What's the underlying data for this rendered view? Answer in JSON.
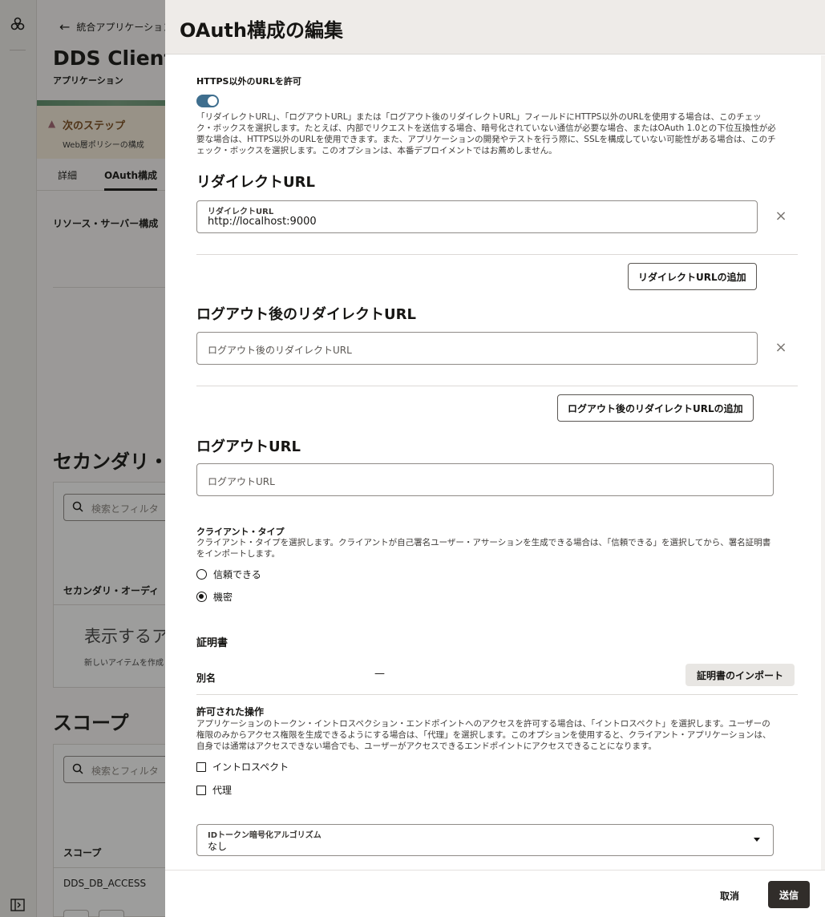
{
  "rail": {
    "logo_icon": "logo-icon",
    "toggle_icon": "panel-toggle-icon"
  },
  "background": {
    "back_label": "統合アプリケーション",
    "app_title": "DDS Client",
    "app_subtitle": "アプリケーション",
    "next_step": {
      "title": "次のステップ",
      "text": "Web層ポリシーの構成"
    },
    "tabs": [
      {
        "label": "詳細"
      },
      {
        "label": "OAuth構成"
      }
    ],
    "resource_server_label": "リソース・サーバー構成",
    "secondary_heading": "セカンダリ・",
    "secondary_card": {
      "search_placeholder": "検索とフィルタ",
      "column": "セカンダリ・オーディ",
      "empty_title": "表示するア",
      "empty_text": "新しいアイテムを作成"
    },
    "scope_heading": "スコープ",
    "scope_card": {
      "search_placeholder": "検索とフィルタ",
      "column": "スコープ",
      "row": "DDS_DB_ACCESS"
    }
  },
  "drawer": {
    "title": "OAuth構成の編集",
    "allow_non_https": {
      "label": "HTTPS以外のURLを許可",
      "enabled": true,
      "help": "「リダイレクトURL」、「ログアウトURL」または「ログアウト後のリダイレクトURL」フィールドにHTTPS以外のURLを使用する場合は、このチェック・ボックスを選択します。たとえば、内部でリクエストを送信する場合、暗号化されていない通信が必要な場合、またはOAuth 1.0との下位互換性が必要な場合は、HTTPS以外のURLを使用できます。また、アプリケーションの開発やテストを行う際に、SSLを構成していない可能性がある場合は、このチェック・ボックスを選択します。このオプションは、本番デプロイメントではお薦めしません。"
    },
    "redirect": {
      "heading": "リダイレクトURL",
      "field_label": "リダイレクトURL",
      "value": "http://localhost:9000",
      "add_button": "リダイレクトURLの追加"
    },
    "post_logout": {
      "heading": "ログアウト後のリダイレクトURL",
      "placeholder": "ログアウト後のリダイレクトURL",
      "add_button": "ログアウト後のリダイレクトURLの追加"
    },
    "logout": {
      "heading": "ログアウトURL",
      "placeholder": "ログアウトURL"
    },
    "client_type": {
      "label": "クライアント・タイプ",
      "help": "クライアント・タイプを選択します。クライアントが自己署名ユーザー・アサーションを生成できる場合は、「信頼できる」を選択してから、署名証明書をインポートします。",
      "options": [
        {
          "label": "信頼できる",
          "selected": false
        },
        {
          "label": "機密",
          "selected": true
        }
      ]
    },
    "certificate": {
      "heading": "証明書",
      "alias_label": "別名",
      "alias_value": "—",
      "import_button": "証明書のインポート"
    },
    "allowed_ops": {
      "label": "許可された操作",
      "help": "アプリケーションのトークン・イントロスペクション・エンドポイントへのアクセスを許可する場合は、「イントロスペクト」を選択します。ユーザーの権限のみからアクセス権限を生成できるようにする場合は、「代理」を選択します。このオプションを使用すると、クライアント・アプリケーションは、自身では通常はアクセスできない場合でも、ユーザーがアクセスできるエンドポイントにアクセスできることになります。",
      "options": [
        {
          "label": "イントロスペクト",
          "checked": false
        },
        {
          "label": "代理",
          "checked": false
        }
      ]
    },
    "id_token_encryption": {
      "label": "IDトークン暗号化アルゴリズム",
      "value": "なし"
    },
    "footer": {
      "cancel": "取消",
      "submit": "送信"
    }
  },
  "colors": {
    "accent": "#3e6e8e",
    "primary_button": "#312d2a",
    "warning": "#a36472"
  }
}
